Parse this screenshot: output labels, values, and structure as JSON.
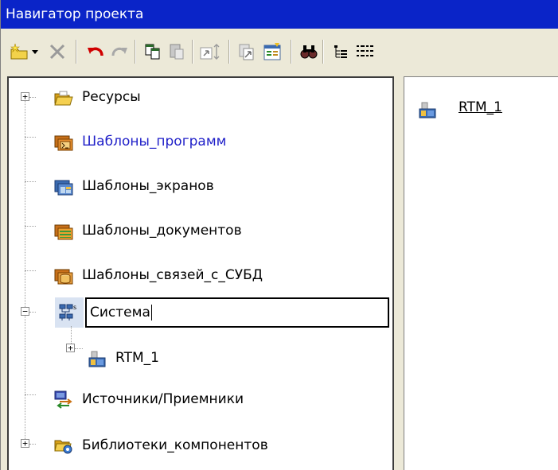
{
  "window": {
    "title": "Навигатор проекта"
  },
  "toolbar": {
    "buttons": [
      {
        "name": "new-folder-icon"
      },
      {
        "name": "dropdown-arrow-icon"
      },
      {
        "name": "delete-icon"
      },
      {
        "name": "undo-icon"
      },
      {
        "name": "redo-icon"
      },
      {
        "name": "copy-icon"
      },
      {
        "name": "paste-icon"
      },
      {
        "name": "move-icon"
      },
      {
        "name": "export-icon"
      },
      {
        "name": "properties-icon"
      },
      {
        "name": "find-icon"
      },
      {
        "name": "tree-view-icon"
      },
      {
        "name": "list-view-icon"
      }
    ]
  },
  "tree": {
    "items": [
      {
        "label": "Ресурсы"
      },
      {
        "label": "Шаблоны_программ"
      },
      {
        "label": "Шаблоны_экранов"
      },
      {
        "label": "Шаблоны_документов"
      },
      {
        "label": "Шаблоны_связей_с_СУБД"
      },
      {
        "label": "Система"
      },
      {
        "label": "RTM_1"
      },
      {
        "label": "Источники/Приемники"
      },
      {
        "label": "Библиотеки_компонентов"
      }
    ],
    "highlight_color": "#1f1fc8"
  },
  "right_pane": {
    "items": [
      {
        "label": "RTM_1"
      }
    ]
  }
}
